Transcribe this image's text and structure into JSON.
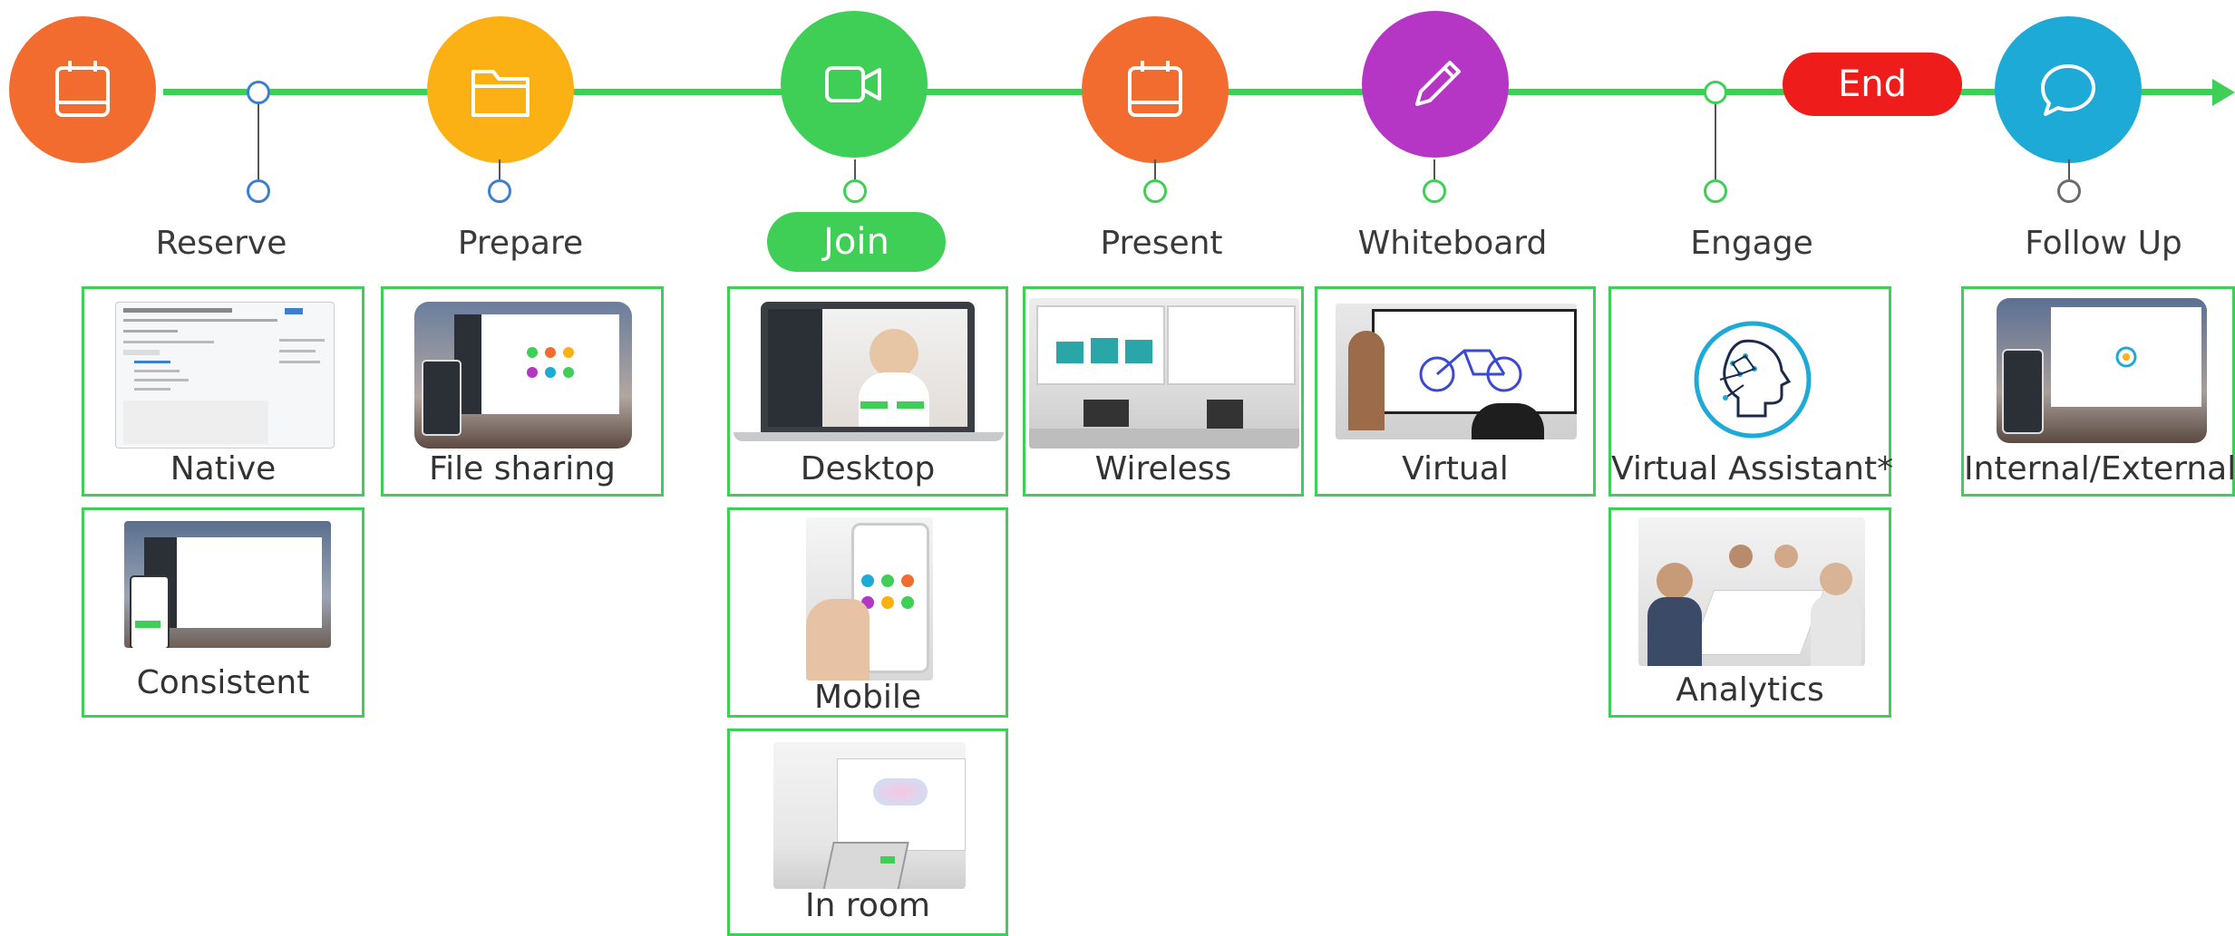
{
  "stages": {
    "reserve": {
      "label": "Reserve",
      "color": "#f26c2f",
      "icon": "calendar-icon"
    },
    "prepare": {
      "label": "Prepare",
      "color": "#fbb014",
      "icon": "folder-icon"
    },
    "join": {
      "label": "Join",
      "color": "#3fcf57",
      "icon": "video-camera-icon"
    },
    "present": {
      "label": "Present",
      "color": "#f26c2f",
      "icon": "calendar-icon"
    },
    "whiteboard": {
      "label": "Whiteboard",
      "color": "#b535c4",
      "icon": "pencil-icon"
    },
    "engage": {
      "label": "Engage"
    },
    "end": {
      "label": "End",
      "color": "#ef1c1c"
    },
    "follow_up": {
      "label": "Follow Up",
      "color": "#1eaad6",
      "icon": "chat-bubble-icon"
    }
  },
  "cards": {
    "native": "Native",
    "consistent": "Consistent",
    "file_sharing": "File sharing",
    "desktop": "Desktop",
    "mobile": "Mobile",
    "in_room": "In room",
    "wireless": "Wireless",
    "virtual": "Virtual",
    "virtual_assistant": "Virtual Assistant*",
    "analytics": "Analytics",
    "internal_external": "Internal/External"
  }
}
